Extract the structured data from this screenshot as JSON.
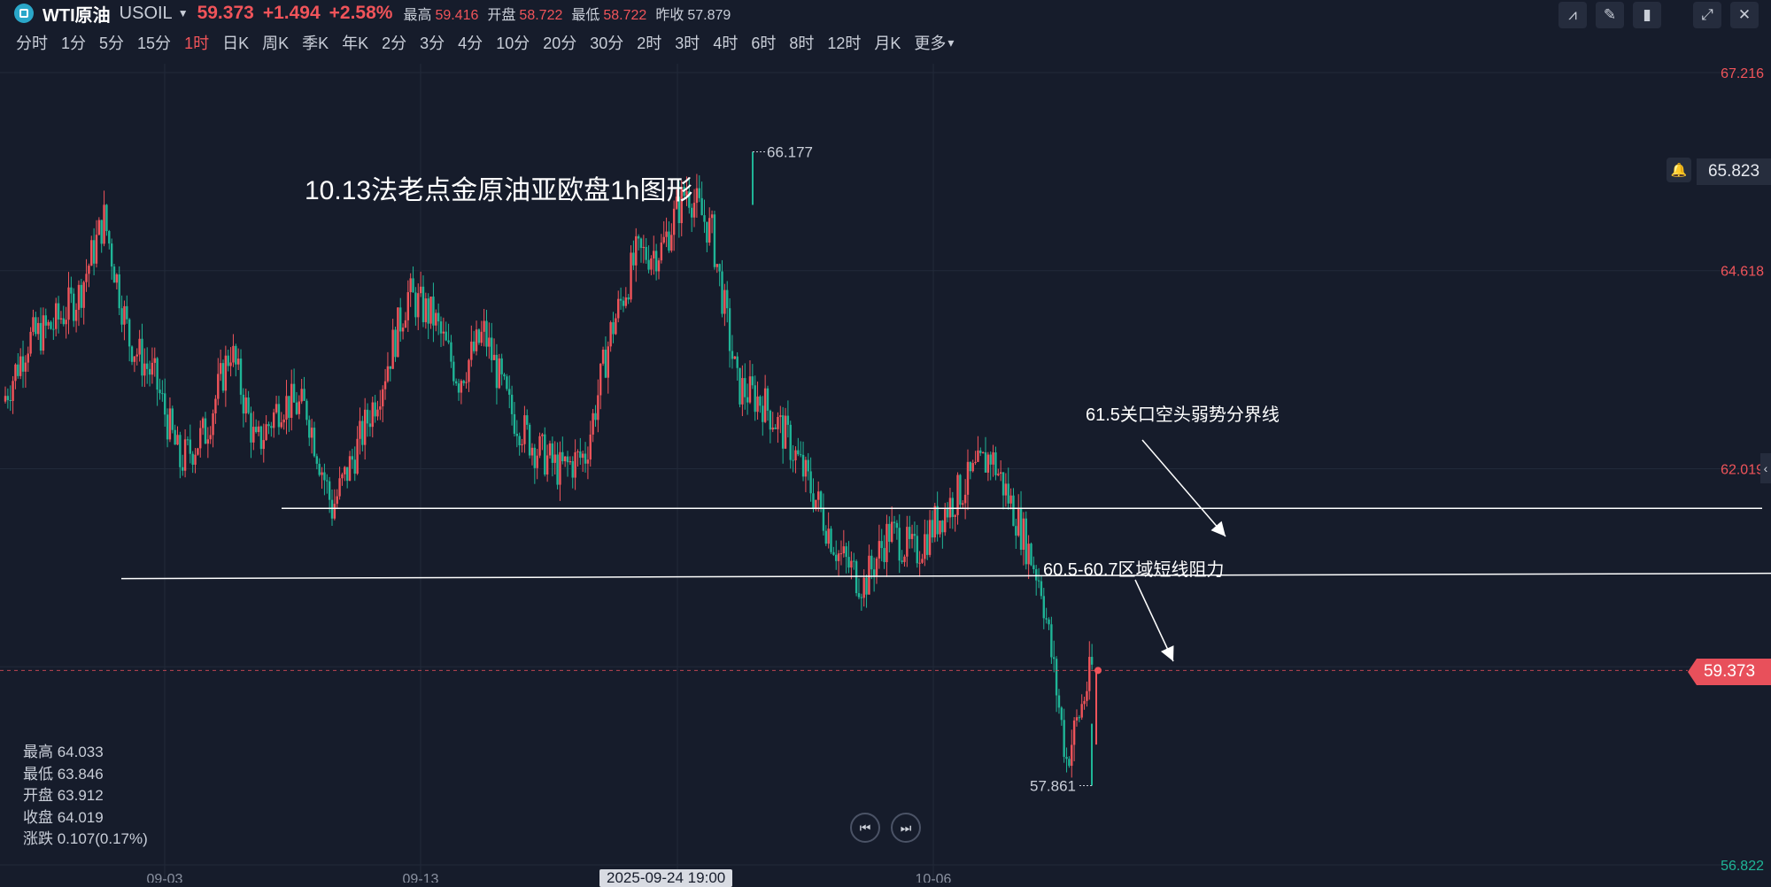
{
  "header": {
    "symbol_name": "WTI原油",
    "symbol_code": "USOIL",
    "last_price": "59.373",
    "change": "+1.494",
    "change_pct": "+2.58%",
    "stats": [
      {
        "label": "最高",
        "value": "59.416",
        "color": "up"
      },
      {
        "label": "开盘",
        "value": "58.722",
        "color": "up"
      },
      {
        "label": "最低",
        "value": "58.722",
        "color": "up"
      },
      {
        "label": "昨收",
        "value": "57.879",
        "color": "neutral"
      }
    ],
    "tools": [
      {
        "name": "indicator-tool-icon",
        "glyph": "⩘"
      },
      {
        "name": "draw-tool-icon",
        "glyph": "✎"
      },
      {
        "name": "candle-type-icon",
        "glyph": "▮"
      },
      {
        "name": "fullscreen-icon",
        "glyph": "⤢"
      },
      {
        "name": "close-icon",
        "glyph": "✕"
      }
    ]
  },
  "timeframes": {
    "items": [
      "分时",
      "1分",
      "5分",
      "15分",
      "1时",
      "日K",
      "周K",
      "季K",
      "年K",
      "2分",
      "3分",
      "4分",
      "10分",
      "20分",
      "30分",
      "2时",
      "3时",
      "4时",
      "6时",
      "8时",
      "12时",
      "月K",
      "更多"
    ],
    "active": "1时"
  },
  "chart_title": "10.13法老点金原油亚欧盘1h图形",
  "ohlc_panel": {
    "high": "最高 64.033",
    "low": "最低 63.846",
    "open": "开盘 63.912",
    "close": "收盘 64.019",
    "change": "涨跌 0.107(0.17%)"
  },
  "annotations": {
    "line1": "61.5关口空头弱势分界线",
    "line2": "60.5-60.7区域短线阻力"
  },
  "price_tags": {
    "current": "59.373",
    "alarm": "65.823",
    "peak": "66.177",
    "trough": "57.861"
  },
  "crosshair_date": "2025-09-24 19:00",
  "colors": {
    "up": "#f0545a",
    "down": "#1fb597",
    "background": "#161c2b"
  },
  "chart_data": {
    "type": "candlestick",
    "timeframe": "1h",
    "ylim": [
      56.822,
      67.216
    ],
    "y_ticks": [
      "67.216",
      "64.618",
      "62.019",
      "59.420",
      "56.822"
    ],
    "x_ticks": [
      "09-03",
      "09-13",
      "2025-09-24 19:00",
      "10-06"
    ],
    "close_path": [
      {
        "x": "08-30",
        "y": 62.9
      },
      {
        "x": "08-31",
        "y": 63.7
      },
      {
        "x": "09-01",
        "y": 63.9
      },
      {
        "x": "09-02",
        "y": 64.3
      },
      {
        "x": "09-03",
        "y": 65.3
      },
      {
        "x": "09-04",
        "y": 63.7
      },
      {
        "x": "09-05",
        "y": 63.2
      },
      {
        "x": "09-06",
        "y": 62.1
      },
      {
        "x": "09-07",
        "y": 62.5
      },
      {
        "x": "09-08",
        "y": 63.6
      },
      {
        "x": "09-09",
        "y": 62.3
      },
      {
        "x": "09-10",
        "y": 62.9
      },
      {
        "x": "09-11",
        "y": 62.8
      },
      {
        "x": "09-12",
        "y": 61.5
      },
      {
        "x": "09-13",
        "y": 62.3
      },
      {
        "x": "09-14",
        "y": 63.2
      },
      {
        "x": "09-15",
        "y": 64.3
      },
      {
        "x": "09-16",
        "y": 64.0
      },
      {
        "x": "09-17",
        "y": 63.2
      },
      {
        "x": "09-18",
        "y": 63.8
      },
      {
        "x": "09-19",
        "y": 62.8
      },
      {
        "x": "09-20",
        "y": 62.3
      },
      {
        "x": "09-21",
        "y": 62.0
      },
      {
        "x": "09-22",
        "y": 62.2
      },
      {
        "x": "09-23",
        "y": 63.8
      },
      {
        "x": "09-24",
        "y": 64.8
      },
      {
        "x": "09-25",
        "y": 64.9
      },
      {
        "x": "09-26",
        "y": 65.7
      },
      {
        "x": "09-27",
        "y": 65.1
      },
      {
        "x": "09-28",
        "y": 63.1
      },
      {
        "x": "09-29",
        "y": 62.9
      },
      {
        "x": "09-30",
        "y": 62.4
      },
      {
        "x": "10-01",
        "y": 61.7
      },
      {
        "x": "10-02",
        "y": 60.9
      },
      {
        "x": "10-03",
        "y": 60.5
      },
      {
        "x": "10-04",
        "y": 61.2
      },
      {
        "x": "10-05",
        "y": 60.9
      },
      {
        "x": "10-06",
        "y": 61.4
      },
      {
        "x": "10-07",
        "y": 61.8
      },
      {
        "x": "10-08",
        "y": 62.2
      },
      {
        "x": "10-09",
        "y": 61.4
      },
      {
        "x": "10-10",
        "y": 60.5
      },
      {
        "x": "10-11",
        "y": 58.2
      },
      {
        "x": "10-12",
        "y": 59.4
      }
    ],
    "peak": 66.177,
    "trough": 57.861,
    "current_price": 59.373,
    "alarm_price": 65.823,
    "horizontal_lines": [
      {
        "label": "61.5关口空头弱势分界线",
        "value": 61.5
      },
      {
        "label": "60.5-60.7区域短线阻力",
        "value": 60.6
      }
    ]
  }
}
